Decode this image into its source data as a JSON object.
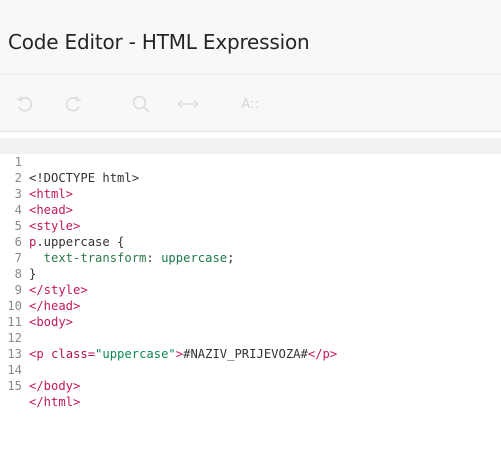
{
  "dialog": {
    "title": "Code Editor - HTML Expression"
  },
  "toolbar": {
    "undo_icon": "undo-icon",
    "redo_icon": "redo-icon",
    "search_icon": "search-icon",
    "replace_icon": "replace-icon",
    "font_label": "A::"
  },
  "colors": {
    "tag": "#c2185b",
    "string": "#0d8a50",
    "line_number": "#8a8a8a",
    "active_line_bg": "#f2f2f2",
    "header_bg": "#f8f8f8"
  },
  "editor": {
    "active_line": 1,
    "lines": [
      {
        "n": "1",
        "t1": "<!DOCTYPE html>"
      },
      {
        "n": "2",
        "t1": "<html>"
      },
      {
        "n": "3",
        "t1": "<head>"
      },
      {
        "n": "4",
        "t1": "<style>"
      },
      {
        "n": "5",
        "t1": "p",
        "t2": ".uppercase {"
      },
      {
        "n": "6",
        "t1": "  text-transform",
        "t2": ": ",
        "t3": "uppercase",
        "t4": ";"
      },
      {
        "n": "7",
        "t1": "}"
      },
      {
        "n": "8",
        "t1": "</style>"
      },
      {
        "n": "9",
        "t1": "</head>"
      },
      {
        "n": "10",
        "t1": "<body>"
      },
      {
        "n": "11",
        "t1": ""
      },
      {
        "n": "12",
        "t1": "<p ",
        "t2": "class=",
        "t3": "\"uppercase\"",
        "t4": ">",
        "t5": "#NAZIV_PRIJEVOZA#",
        "t6": "</p>"
      },
      {
        "n": "13",
        "t1": ""
      },
      {
        "n": "14",
        "t1": "</body>"
      },
      {
        "n": "15",
        "t1": "</html>"
      }
    ]
  }
}
